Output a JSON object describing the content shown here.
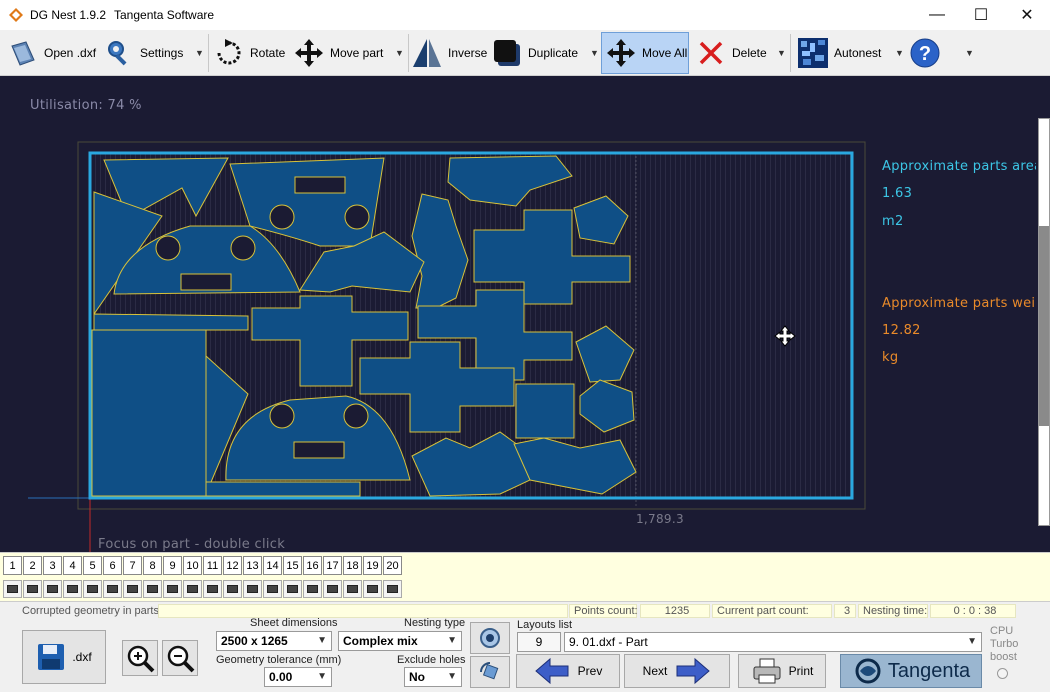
{
  "window": {
    "app_title": "DG Nest 1.9.2",
    "company": "Tangenta Software",
    "minimize": "—",
    "maximize": "☐",
    "close": "✕"
  },
  "toolbar": {
    "open_label": "Open .dxf",
    "settings_label": "Settings",
    "rotate_label": "Rotate",
    "move_part_label": "Move part",
    "inverse_label": "Inverse",
    "duplicate_label": "Duplicate",
    "move_all_label": "Move All",
    "delete_label": "Delete",
    "autonest_label": "Autonest",
    "dropdown_arrow": "▼"
  },
  "canvas": {
    "utilisation": "Utilisation: 74 %",
    "parts_area_title": "Approximate parts area",
    "parts_area_value": "1.63",
    "parts_area_unit": "m2",
    "parts_weight_title": "Approximate parts weigh",
    "parts_weight_value": "12.82",
    "parts_weight_unit": "kg",
    "ruler_value": "1,789.3",
    "hint": "Focus on part - double click",
    "colors": {
      "background": "#1b1b33",
      "sheet_border": "#2aa8e0",
      "part_fill": "#0f4f86",
      "part_stroke": "#d8c23a",
      "area_text": "#3cc6e6",
      "weight_text": "#e98a2a"
    }
  },
  "pages": [
    "1",
    "2",
    "3",
    "4",
    "5",
    "6",
    "7",
    "8",
    "9",
    "10",
    "11",
    "12",
    "13",
    "14",
    "15",
    "16",
    "17",
    "18",
    "19",
    "20"
  ],
  "status": {
    "corrupted_label": "Corrupted geometry in parts:",
    "points_count_label": "Points count:",
    "points_count_value": "1235",
    "current_part_count_label": "Current part count:",
    "current_part_count_value": "3",
    "nesting_time_label": "Nesting time:",
    "nesting_time_value": "0 : 0 : 38",
    "save_dxf_label": ".dxf",
    "sheet_dimensions_label": "Sheet dimensions",
    "sheet_dimensions_value": "2500 x 1265",
    "geometry_tolerance_label": "Geometry tolerance (mm)",
    "geometry_tolerance_value": "0.00",
    "nesting_type_label": "Nesting type",
    "nesting_type_value": "Complex mix",
    "exclude_holes_label": "Exclude holes",
    "exclude_holes_value": "No",
    "layouts_list_label": "Layouts list",
    "layouts_count": "9",
    "layouts_selected": "9. 01.dxf - Part",
    "prev_label": "Prev",
    "next_label": "Next",
    "print_label": "Print",
    "brand": "Tangenta",
    "cpu_turbo_label": "CPU\nTurbo\nboost"
  }
}
